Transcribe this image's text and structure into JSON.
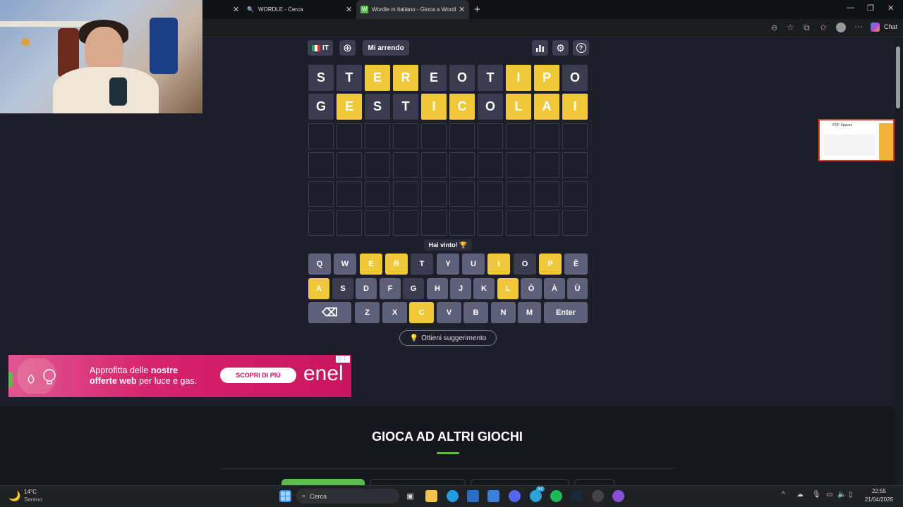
{
  "browser": {
    "tabs": [
      {
        "label": "WORDLE - Cerca"
      },
      {
        "label": "Wordle in Italiano - Gioca a Wordle"
      }
    ],
    "new_tab_symbol": "+",
    "chat_label": "Chat"
  },
  "game": {
    "language_code": "IT",
    "give_up_label": "Mi arrendo",
    "rows": [
      [
        {
          "letter": "S",
          "state": "absent"
        },
        {
          "letter": "T",
          "state": "absent"
        },
        {
          "letter": "E",
          "state": "present"
        },
        {
          "letter": "R",
          "state": "present"
        },
        {
          "letter": "E",
          "state": "absent"
        },
        {
          "letter": "O",
          "state": "absent"
        },
        {
          "letter": "T",
          "state": "absent"
        },
        {
          "letter": "I",
          "state": "present"
        },
        {
          "letter": "P",
          "state": "present"
        },
        {
          "letter": "O",
          "state": "absent"
        }
      ],
      [
        {
          "letter": "G",
          "state": "absent"
        },
        {
          "letter": "E",
          "state": "present"
        },
        {
          "letter": "S",
          "state": "absent"
        },
        {
          "letter": "T",
          "state": "absent"
        },
        {
          "letter": "I",
          "state": "present"
        },
        {
          "letter": "C",
          "state": "present"
        },
        {
          "letter": "O",
          "state": "absent"
        },
        {
          "letter": "L",
          "state": "present"
        },
        {
          "letter": "A",
          "state": "present"
        },
        {
          "letter": "I",
          "state": "present"
        }
      ]
    ],
    "empty_rows": 4,
    "status_message": "Hai vinto! 🏆",
    "keyboard": [
      [
        {
          "key": "Q",
          "state": "unused"
        },
        {
          "key": "W",
          "state": "unused"
        },
        {
          "key": "E",
          "state": "present"
        },
        {
          "key": "R",
          "state": "present"
        },
        {
          "key": "T",
          "state": "absent"
        },
        {
          "key": "Y",
          "state": "unused"
        },
        {
          "key": "U",
          "state": "unused"
        },
        {
          "key": "I",
          "state": "present"
        },
        {
          "key": "O",
          "state": "absent"
        },
        {
          "key": "P",
          "state": "present"
        },
        {
          "key": "È",
          "state": "unused"
        }
      ],
      [
        {
          "key": "A",
          "state": "present"
        },
        {
          "key": "S",
          "state": "absent"
        },
        {
          "key": "D",
          "state": "unused"
        },
        {
          "key": "F",
          "state": "unused"
        },
        {
          "key": "G",
          "state": "absent"
        },
        {
          "key": "H",
          "state": "unused"
        },
        {
          "key": "J",
          "state": "unused"
        },
        {
          "key": "K",
          "state": "unused"
        },
        {
          "key": "L",
          "state": "present"
        },
        {
          "key": "Ò",
          "state": "unused"
        },
        {
          "key": "À",
          "state": "unused"
        },
        {
          "key": "Ù",
          "state": "unused"
        }
      ],
      [
        {
          "key": "⌫",
          "state": "unused"
        },
        {
          "key": "Z",
          "state": "unused"
        },
        {
          "key": "X",
          "state": "unused"
        },
        {
          "key": "C",
          "state": "present"
        },
        {
          "key": "V",
          "state": "unused"
        },
        {
          "key": "B",
          "state": "unused"
        },
        {
          "key": "N",
          "state": "unused"
        },
        {
          "key": "M",
          "state": "unused"
        },
        {
          "key": "Enter",
          "state": "unused"
        }
      ]
    ],
    "suggest_label": "Ottieni suggerimento"
  },
  "ad": {
    "line1_pre": "Approfitta delle ",
    "line1_bold": "nostre",
    "line2_bold": "offerte web",
    "line2_post": " per luce e gas.",
    "cta": "SCOPRI DI PIÙ",
    "brand": "enel"
  },
  "side_ad": {
    "label": "PDF Spaces"
  },
  "section": {
    "heading": "GIOCA AD ALTRI GIOCHI"
  },
  "taskbar": {
    "weather_temp": "14°C",
    "weather_desc": "Sereno",
    "search_label": "Cerca",
    "badge_count": "37",
    "time": "22:55",
    "date": "21/04/2026"
  },
  "colors": {
    "present": "#f0c93a",
    "absent": "#3b3c50",
    "unused": "#5e6079",
    "accent": "#5bbb4c"
  }
}
